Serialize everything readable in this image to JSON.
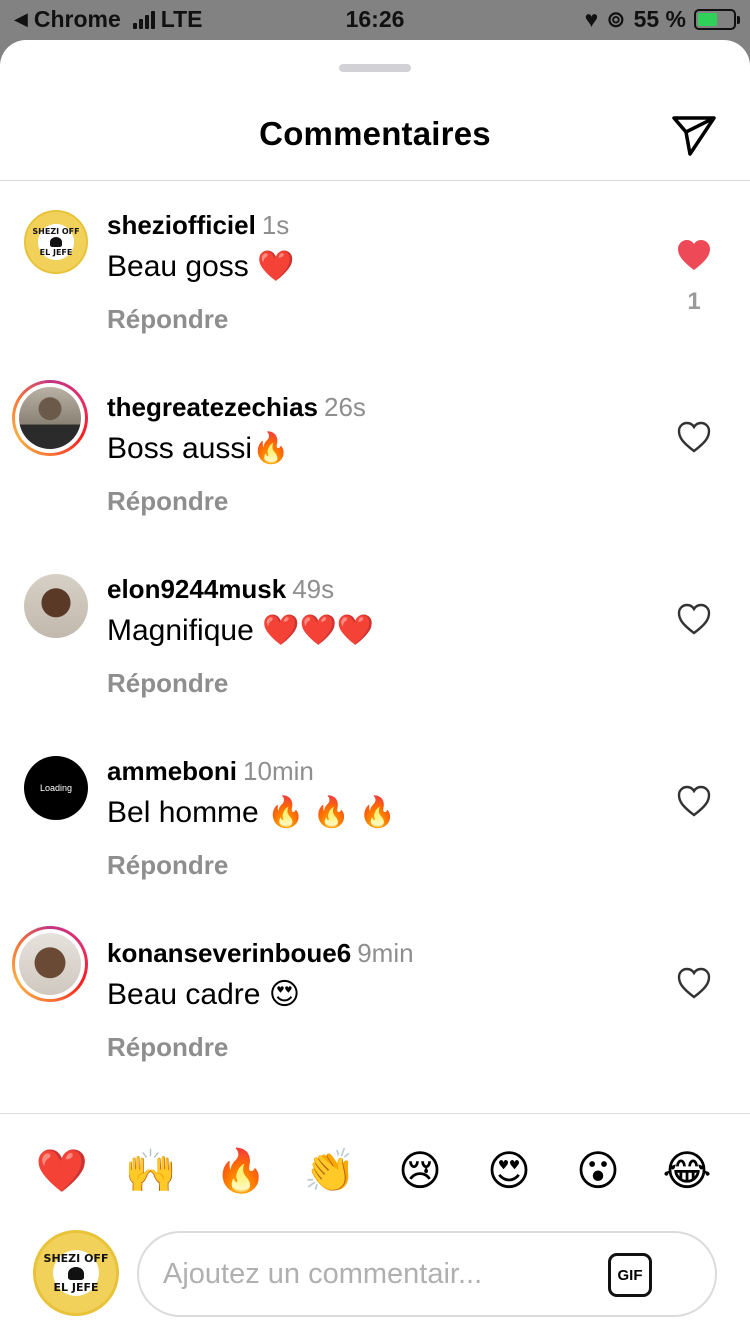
{
  "status_bar": {
    "back_app": "Chrome",
    "network": "LTE",
    "time": "16:26",
    "battery": "55 %",
    "battery_level": 0.55
  },
  "header": {
    "title": "Commentaires",
    "icon": "send-icon"
  },
  "comments": [
    {
      "username": "sheziofficiel",
      "time": "1s",
      "text": "Beau goss ❤️",
      "reply": "Répondre",
      "liked": true,
      "likes": "1"
    },
    {
      "username": "thegreatezechias",
      "time": "26s",
      "text": "Boss aussi🔥",
      "reply": "Répondre",
      "liked": false
    },
    {
      "username": "elon9244musk",
      "time": "49s",
      "text": "Magnifique ❤️❤️❤️",
      "reply": "Répondre",
      "liked": false
    },
    {
      "username": "ammeboni",
      "time": "10min",
      "text": "Bel homme 🔥 🔥 🔥",
      "reply": "Répondre",
      "liked": false,
      "avatar_text": "Loading"
    },
    {
      "username": "konanseverinboue6",
      "time": "9min",
      "text": "Beau cadre 😍",
      "reply": "Répondre",
      "liked": false
    }
  ],
  "quick_emojis": [
    "❤️",
    "🙌",
    "🔥",
    "👏",
    "😢",
    "😍",
    "😮",
    "😂"
  ],
  "composer": {
    "placeholder": "Ajoutez un commentair...",
    "gif_label": "GIF",
    "avatar_line1": "SHEZI OFF",
    "avatar_line2": "EL JEFE"
  },
  "colors": {
    "like_active": "#ed4956",
    "muted_text": "#8e8e8e",
    "divider": "#dbdbdb"
  }
}
